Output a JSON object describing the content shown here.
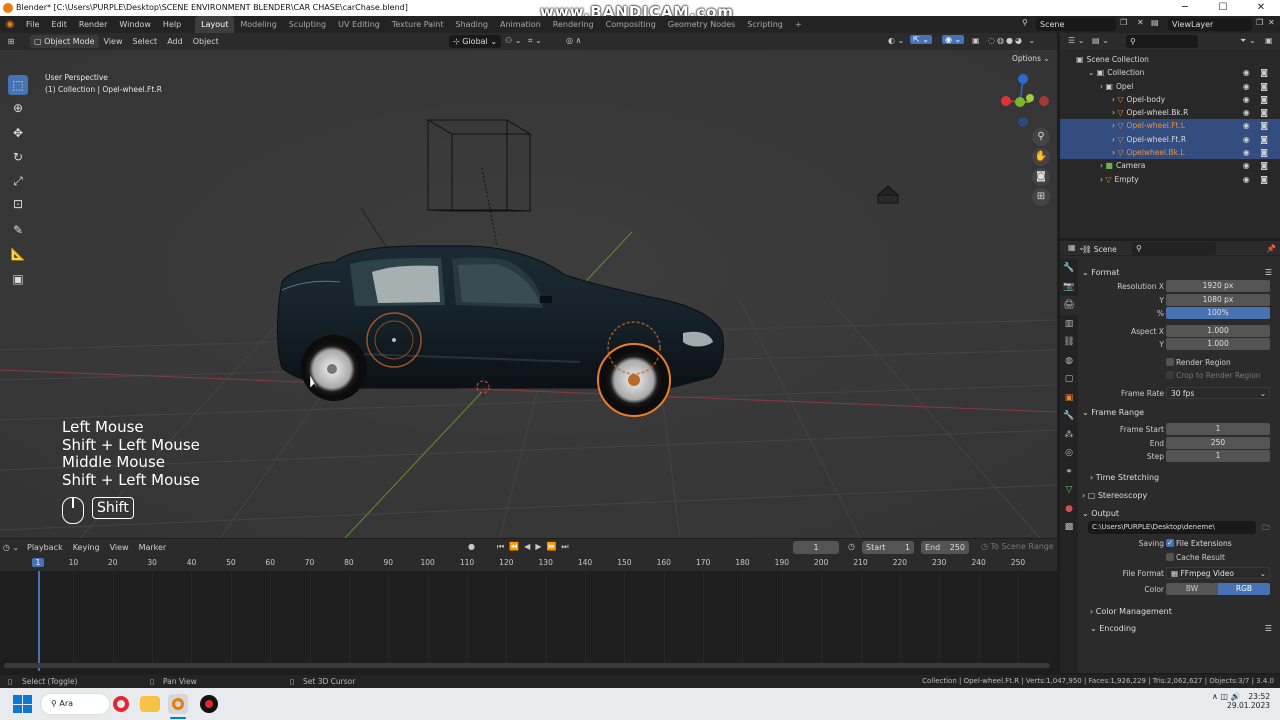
{
  "window": {
    "title": "Blender* [C:\\Users\\PURPLE\\Desktop\\SCENE ENVIRONMENT BLENDER\\CAR CHASE\\carChase.blend]",
    "watermark": "www.BANDICAM.com",
    "controls": [
      "─",
      "☐",
      "✕"
    ]
  },
  "menu": [
    "File",
    "Edit",
    "Render",
    "Window",
    "Help"
  ],
  "workspaces": [
    "Layout",
    "Modeling",
    "Sculpting",
    "UV Editing",
    "Texture Paint",
    "Shading",
    "Animation",
    "Rendering",
    "Compositing",
    "Geometry Nodes",
    "Scripting",
    "+"
  ],
  "scene_field": "Scene",
  "viewlayer_field": "ViewLayer",
  "viewport_header": {
    "mode": "Object Mode",
    "menus": [
      "View",
      "Select",
      "Add",
      "Object"
    ],
    "orientation": "Global",
    "options_label": "Options"
  },
  "viewport": {
    "perspective": "User Perspective",
    "collection_info": "(1) Collection | Opel-wheel.Ft.R",
    "accent_color": "#4772b3",
    "selection_color": "#e8812c"
  },
  "key_overlay": {
    "lines": [
      "Left Mouse",
      "Shift + Left Mouse",
      "Middle Mouse",
      "Shift + Left Mouse"
    ],
    "key": "Shift"
  },
  "outliner": {
    "rows": [
      {
        "label": "Scene Collection",
        "icon": "▣",
        "indent": 0,
        "selected": false,
        "orange": false
      },
      {
        "label": "Collection",
        "icon": "▣",
        "indent": 1,
        "selected": false,
        "orange": false
      },
      {
        "label": "Opel",
        "icon": "▣",
        "indent": 2,
        "selected": false,
        "orange": false
      },
      {
        "label": "Opel-body",
        "icon": "▽",
        "indent": 3,
        "selected": false,
        "orange": false
      },
      {
        "label": "Opel-wheel.Bk.R",
        "icon": "▽",
        "indent": 3,
        "selected": false,
        "orange": false
      },
      {
        "label": "Opel-wheel.Ft.L",
        "icon": "▽",
        "indent": 3,
        "selected": true,
        "orange": true
      },
      {
        "label": "Opel-wheel.Ft.R",
        "icon": "▽",
        "indent": 3,
        "selected": true,
        "orange": false
      },
      {
        "label": "Opelwheel.Bk.L",
        "icon": "▽",
        "indent": 3,
        "selected": true,
        "orange": true
      },
      {
        "label": "Camera",
        "icon": "■",
        "indent": 2,
        "selected": false,
        "orange": false
      },
      {
        "label": "Empty",
        "icon": "▽",
        "indent": 2,
        "selected": false,
        "orange": false
      }
    ]
  },
  "properties": {
    "scene_label": "Scene",
    "format": {
      "title": "Format",
      "resolution_x_label": "Resolution X",
      "resolution_x": "1920 px",
      "y_label": "Y",
      "resolution_y": "1080 px",
      "pct_label": "%",
      "percent": "100%",
      "aspect_x_label": "Aspect X",
      "aspect_x": "1.000",
      "aspect_y_label": "Y",
      "aspect_y": "1.000",
      "render_region": "Render Region",
      "crop_region": "Crop to Render Region",
      "frame_rate_label": "Frame Rate",
      "frame_rate": "30 fps"
    },
    "frame_range": {
      "title": "Frame Range",
      "start_label": "Frame Start",
      "start": "1",
      "end_label": "End",
      "end": "250",
      "step_label": "Step",
      "step": "1"
    },
    "time_stretching": "Time Stretching",
    "stereoscopy": "Stereoscopy",
    "output": {
      "title": "Output",
      "path": "C:\\Users\\PURPLE\\Desktop\\deneme\\",
      "saving_label": "Saving",
      "file_extensions": "File Extensions",
      "cache_result": "Cache Result",
      "file_format_label": "File Format",
      "file_format": "FFmpeg Video",
      "color_label": "Color",
      "bw": "BW",
      "rgb": "RGB"
    },
    "color_management": "Color Management",
    "encoding": "Encoding"
  },
  "timeline": {
    "menus": [
      "Playback",
      "Keying",
      "View",
      "Marker"
    ],
    "current_frame": "1",
    "start_label": "Start",
    "start": "1",
    "end_label": "End",
    "end": "250",
    "to_scene_range": "To Scene Range",
    "ticks": [
      "1",
      "10",
      "20",
      "30",
      "40",
      "50",
      "60",
      "70",
      "80",
      "90",
      "100",
      "110",
      "120",
      "130",
      "140",
      "150",
      "160",
      "170",
      "180",
      "190",
      "200",
      "210",
      "220",
      "230",
      "240",
      "250"
    ]
  },
  "statusbar": {
    "left1": "Select (Toggle)",
    "left2": "Pan View",
    "left3": "Set 3D Cursor",
    "right": "Collection | Opel-wheel.Ft.R | Verts:1,047,950 | Faces:1,926,229 | Tris:2,062,627 | Objects:3/7 | 3.4.0"
  },
  "taskbar": {
    "search": "Ara",
    "time": "23:52",
    "date": "29.01.2023"
  }
}
